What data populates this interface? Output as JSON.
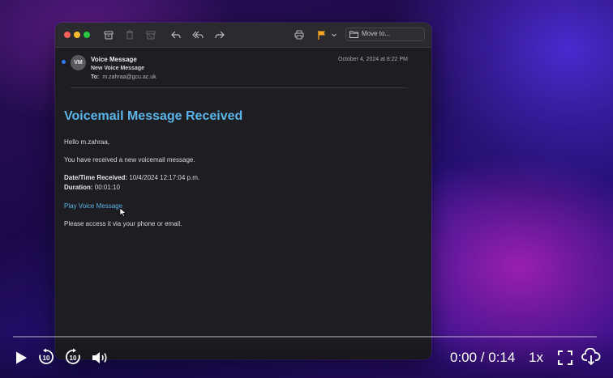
{
  "toolbar": {
    "move_to_label": "Move to..."
  },
  "email": {
    "avatar_initials": "VM",
    "sender": "Voice Message",
    "subject": "New Voice Message",
    "to_label": "To:",
    "to_address": "m.zahraa@gcu.ac.uk",
    "date": "October 4, 2024 at 8:22 PM",
    "body": {
      "title": "Voicemail Message Received",
      "greeting": "Hello m.zahraa,",
      "intro": "You have received a new voicemail message.",
      "datetime_label": "Date/Time Received:",
      "datetime_value": "10/4/2024 12:17:04 p.m.",
      "duration_label": "Duration:",
      "duration_value": "00:01:10",
      "link_text": "Play Voice Message",
      "footer": "Please access it via your phone or email."
    }
  },
  "player": {
    "time": "0:00 / 0:14",
    "speed": "1x",
    "skip_back_seconds": "10",
    "skip_forward_seconds": "10",
    "progress_fraction": 0
  },
  "colors": {
    "close": "#ff5f57",
    "minimize": "#febc2e",
    "zoom": "#28c840",
    "flag": "#f5a623",
    "link": "#5ab4e6",
    "unread_dot": "#2f7df6"
  }
}
